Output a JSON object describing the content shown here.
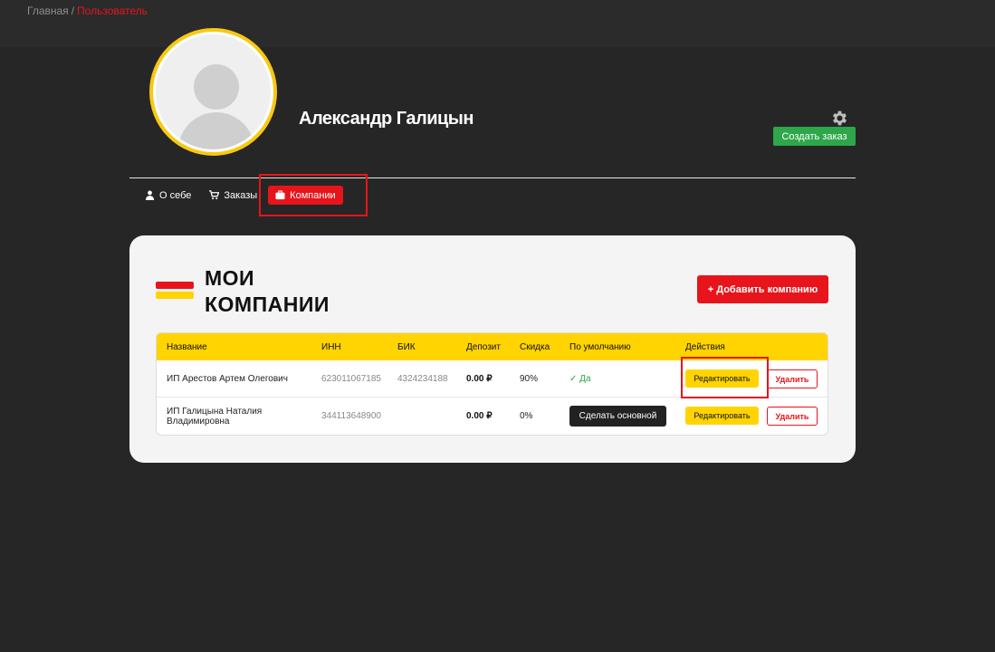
{
  "breadcrumb": {
    "home": "Главная",
    "separator": "/",
    "current": "Пользователь"
  },
  "profile": {
    "name": "Александр Галицын",
    "create_order_label": "Создать заказ",
    "settings_icon": "gear-icon"
  },
  "tabs": [
    {
      "label": "О себе",
      "icon": "user-icon"
    },
    {
      "label": "Заказы",
      "icon": "cart-icon"
    },
    {
      "label": "Компании",
      "icon": "briefcase-icon",
      "active": true
    }
  ],
  "companies": {
    "title_line1": "МОИ",
    "title_line2": "КОМПАНИИ",
    "add_label": "+ Добавить компанию",
    "columns": [
      "Название",
      "ИНН",
      "БИК",
      "Депозит",
      "Скидка",
      "По умолчанию",
      "Действия"
    ],
    "rows": [
      {
        "name": "ИП Арестов Артем Олегович",
        "inn": "623011067185",
        "bik": "4324234188",
        "deposit": "0.00 ₽",
        "discount": "90%",
        "default": "Да",
        "edit": "Редактировать",
        "delete": "Удалить"
      },
      {
        "name_line1": "ИП Галицына Наталия",
        "name_line2": "Владимировна",
        "inn": "344113648900",
        "bik": "",
        "deposit": "0.00 ₽",
        "discount": "0%",
        "make_default": "Сделать основной",
        "edit": "Редактировать",
        "delete": "Удалить"
      }
    ]
  },
  "colors": {
    "accent_red": "#e8141b",
    "accent_yellow": "#ffd400",
    "green": "#2ea64a",
    "background": "#262626"
  }
}
